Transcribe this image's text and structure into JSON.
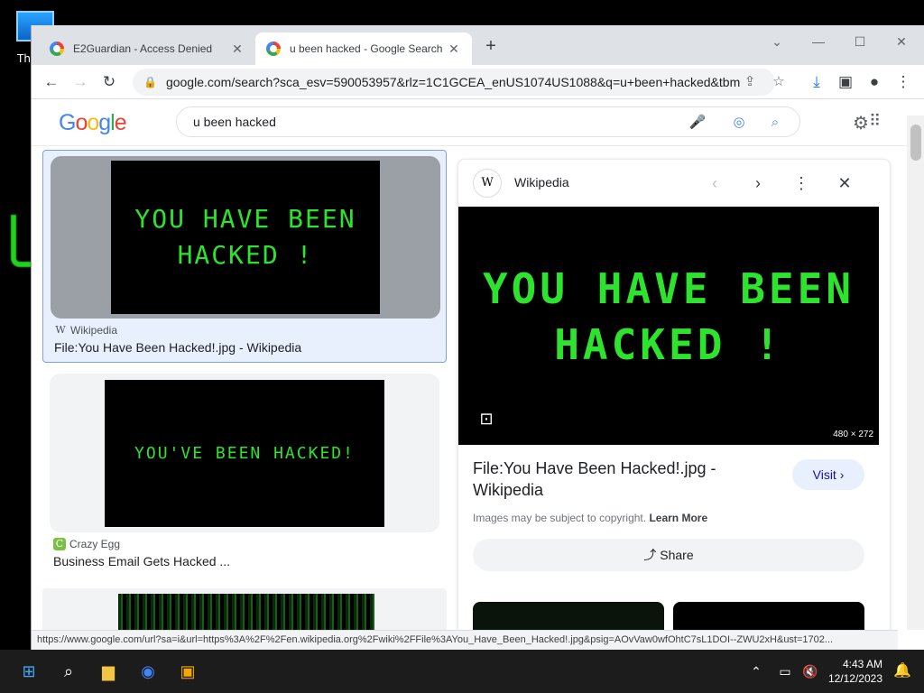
{
  "desktop": {
    "icon_label": "Th"
  },
  "tabs": [
    {
      "title": "E2Guardian - Access Denied",
      "close": "✕"
    },
    {
      "title": "u been hacked - Google Search",
      "close": "✕"
    }
  ],
  "new_tab": "+",
  "window_controls": {
    "tabsearch": "⌄",
    "minimize": "—",
    "maximize": "☐",
    "close": "✕"
  },
  "toolbar": {
    "url": "google.com/search?sca_esv=590053957&rlz=1C1GCEA_enUS1074US1088&q=u+been+hacked&tbm..."
  },
  "google": {
    "logo": "Google",
    "search_query": "u been hacked"
  },
  "results": [
    {
      "source": "Wikipedia",
      "title": "File:You Have Been Hacked!.jpg - Wikipedia",
      "image_line1": "YOU HAVE BEEN",
      "image_line2": "HACKED !"
    },
    {
      "source": "Crazy Egg",
      "title": "Business Email Gets Hacked ...",
      "image_line1": "YOU'VE BEEN HACKED!"
    }
  ],
  "panel": {
    "source": "Wikipedia",
    "image_line1": "YOU HAVE BEEN",
    "image_line2": "HACKED !",
    "dims": "480 × 272",
    "title": "File:You Have Been Hacked!.jpg - Wikipedia",
    "visit": "Visit ›",
    "copyright": "Images may be subject to copyright.",
    "learn_more": "Learn More",
    "share": "Share"
  },
  "statusbar": "https://www.google.com/url?sa=i&url=https%3A%2F%2Fen.wikipedia.org%2Fwiki%2FFile%3AYou_Have_Been_Hacked!.jpg&psig=AOvVaw0wfOhtC7sL1DOI--ZWU2xH&ust=1702...",
  "taskbar": {
    "time": "4:43 AM",
    "date": "12/12/2023"
  }
}
